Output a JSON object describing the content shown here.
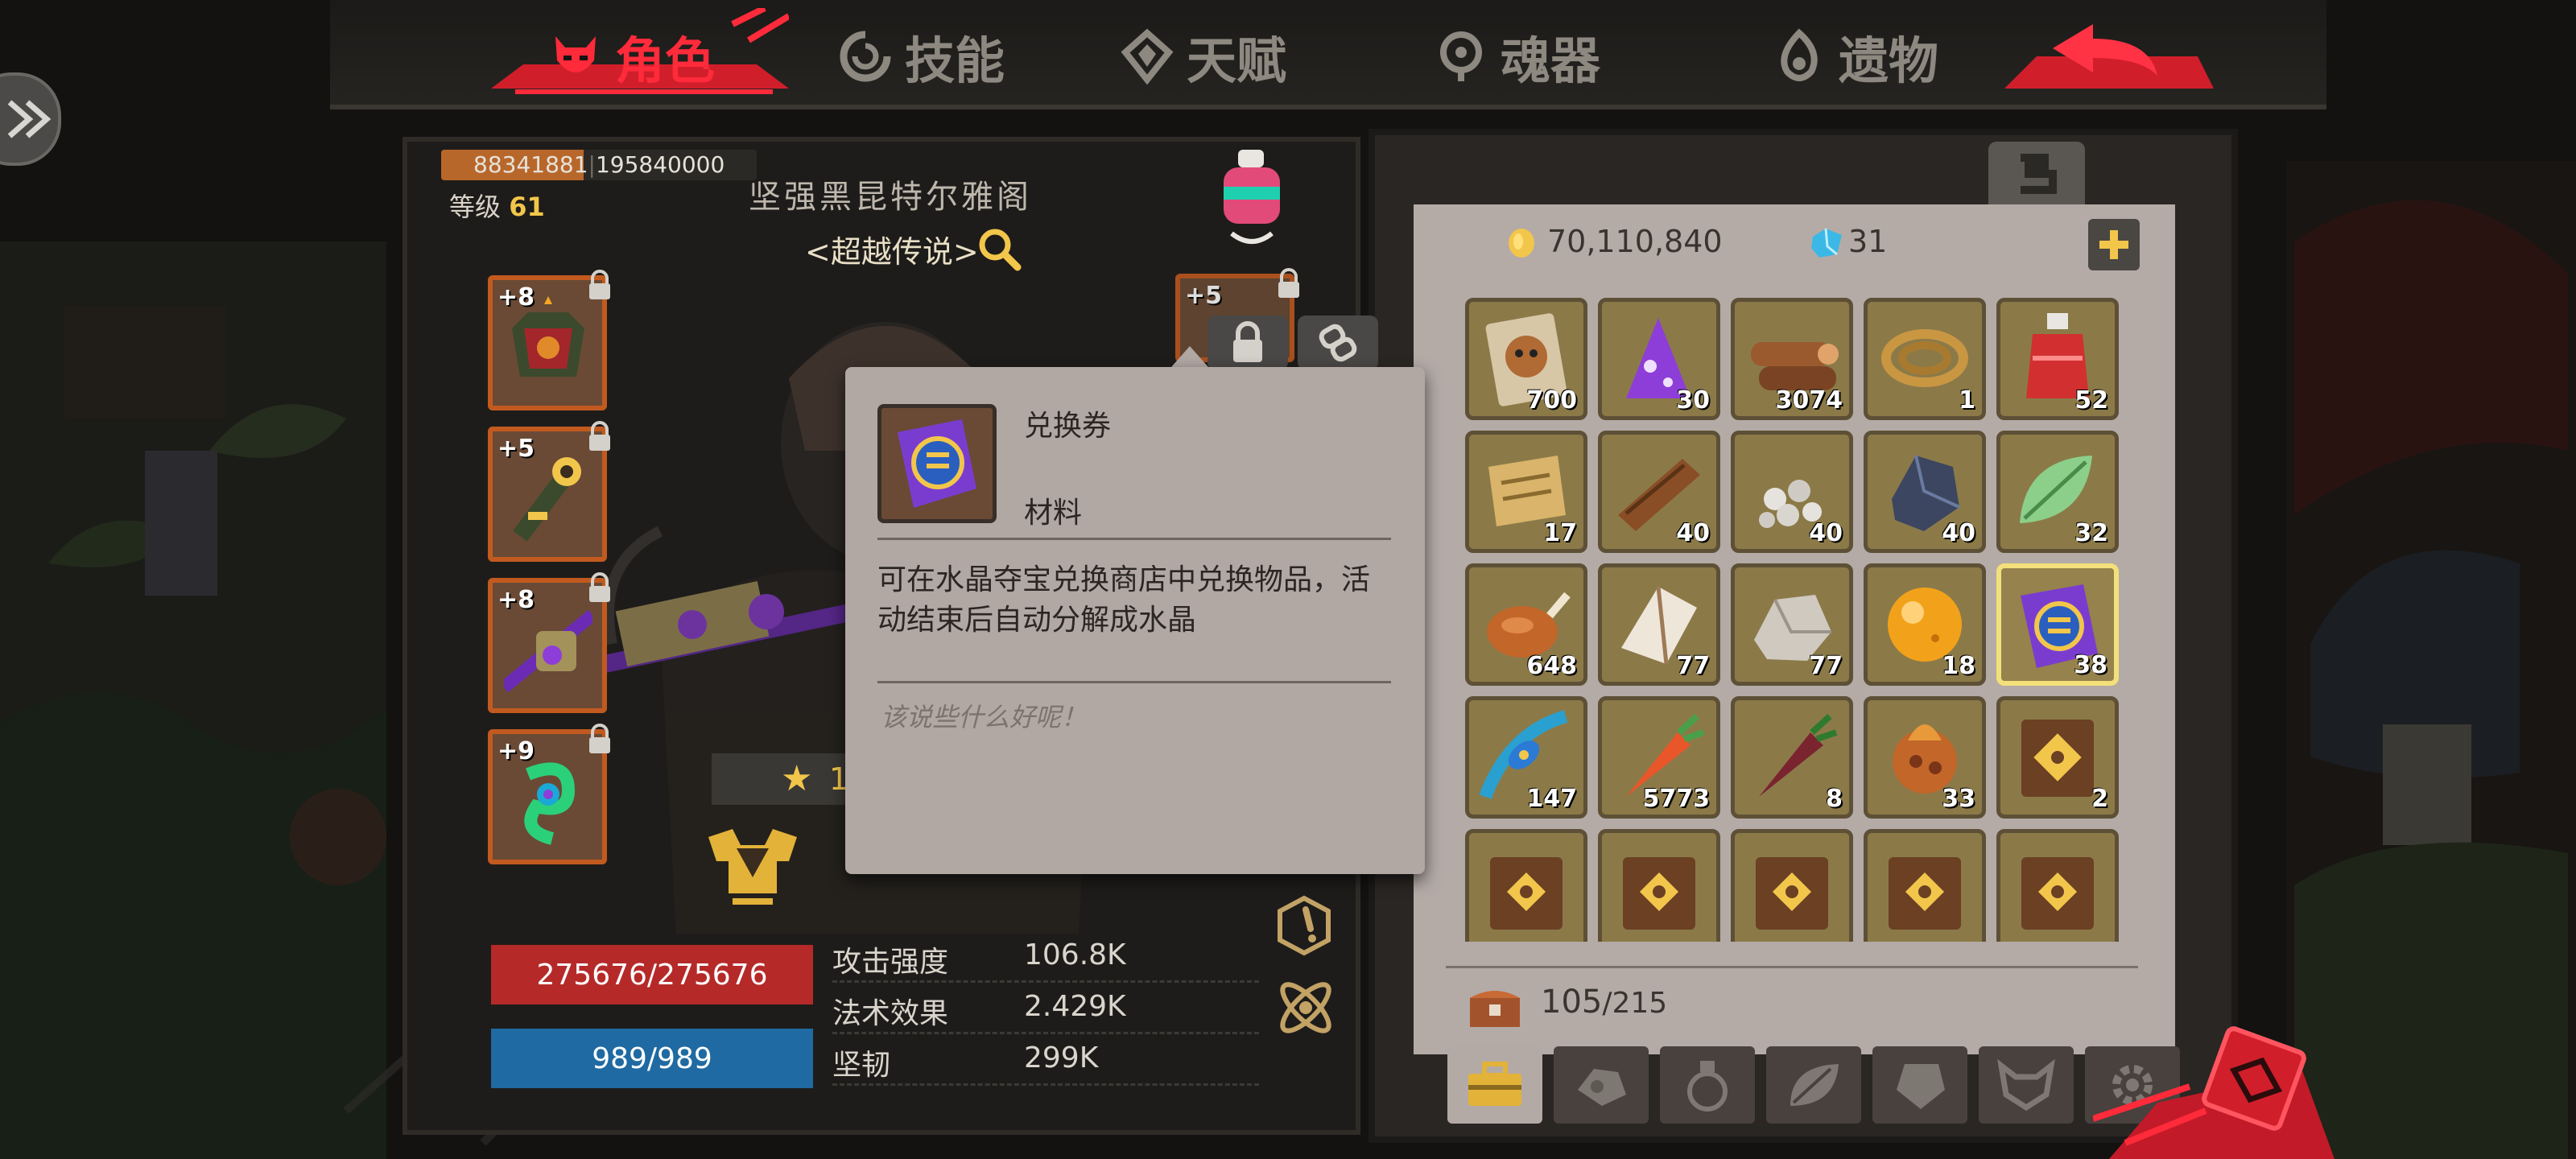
{
  "tabs": [
    {
      "label": "角色",
      "icon": "devil-face-icon",
      "active": true
    },
    {
      "label": "技能",
      "icon": "skill-swirl-icon",
      "active": false
    },
    {
      "label": "天赋",
      "icon": "talent-gem-icon",
      "active": false
    },
    {
      "label": "魂器",
      "icon": "soul-vessel-icon",
      "active": false
    },
    {
      "label": "遗物",
      "icon": "relic-flame-icon",
      "active": false
    }
  ],
  "character": {
    "exp_current": "88341881",
    "exp_max": "195840000",
    "exp_fraction": 0.451,
    "level_label": "等级",
    "level": "61",
    "name": "坚强黑昆特尔雅阁",
    "rank": "<超越传说>",
    "equipment": [
      {
        "level": "+8",
        "icon": "armor-icon",
        "locked": true
      },
      {
        "level": "+5",
        "icon": "key-weapon-icon",
        "locked": true
      },
      {
        "level": "+8",
        "icon": "crossbow-icon",
        "locked": true
      },
      {
        "level": "+9",
        "icon": "green-rune-icon",
        "locked": true
      },
      {
        "level": "+5",
        "icon": "claw-weapon-icon",
        "locked": true
      }
    ],
    "star_value": "1",
    "hp": "275676/275676",
    "mp": "989/989",
    "stats": [
      {
        "label": "攻击强度",
        "value": "106.8K"
      },
      {
        "label": "法术效果",
        "value": "2.429K"
      },
      {
        "label": "坚韧",
        "value": "299K"
      }
    ]
  },
  "tooltip": {
    "name": "兑换券",
    "type": "材料",
    "description": "可在水晶夺宝兑换商店中兑换物品，活动结束后自动分解成水晶",
    "flavor": "该说些什么好呢！"
  },
  "inventory": {
    "gold": "70,110,840",
    "gems": "31",
    "capacity_used": "105",
    "capacity_max": "/215",
    "items": [
      {
        "icon": "raccoon-card-icon",
        "qty": "700"
      },
      {
        "icon": "purple-crystal-icon",
        "qty": "30"
      },
      {
        "icon": "wood-logs-icon",
        "qty": "3074"
      },
      {
        "icon": "rope-coil-icon",
        "qty": "1"
      },
      {
        "icon": "red-potion-icon",
        "qty": "52"
      },
      {
        "icon": "scroll-map-icon",
        "qty": "17"
      },
      {
        "icon": "wood-plank-icon",
        "qty": "40"
      },
      {
        "icon": "gravel-icon",
        "qty": "40"
      },
      {
        "icon": "dark-ore-icon",
        "qty": "40"
      },
      {
        "icon": "green-leaf-icon",
        "qty": "32"
      },
      {
        "icon": "roast-chicken-icon",
        "qty": "648"
      },
      {
        "icon": "white-stone-icon",
        "qty": "77"
      },
      {
        "icon": "grey-rock-icon",
        "qty": "77"
      },
      {
        "icon": "orange-orb-icon",
        "qty": "18"
      },
      {
        "icon": "exchange-ticket-icon",
        "qty": "38",
        "selected": true
      },
      {
        "icon": "peacock-feather-icon",
        "qty": "147"
      },
      {
        "icon": "carrot-icon",
        "qty": "5773"
      },
      {
        "icon": "dark-carrot-icon",
        "qty": "8"
      },
      {
        "icon": "fire-fruit-icon",
        "qty": "33"
      },
      {
        "icon": "gold-book-icon",
        "qty": "2"
      },
      {
        "icon": "skill-book-icon",
        "qty": ""
      },
      {
        "icon": "skill-book-icon",
        "qty": ""
      },
      {
        "icon": "skill-book-icon",
        "qty": ""
      },
      {
        "icon": "skill-book-icon",
        "qty": ""
      },
      {
        "icon": "skill-book-icon",
        "qty": ""
      }
    ],
    "categories": [
      {
        "icon": "toolbox-icon",
        "active": true
      },
      {
        "icon": "ore-icon",
        "active": false
      },
      {
        "icon": "potion-icon",
        "active": false
      },
      {
        "icon": "leaf-icon",
        "active": false
      },
      {
        "icon": "gem-icon",
        "active": false
      },
      {
        "icon": "beast-icon",
        "active": false
      },
      {
        "icon": "gear-icon",
        "active": false
      }
    ]
  },
  "colors": {
    "accent_red": "#ff2a3a",
    "hp": "#b52a29",
    "mp": "#1f6aa2",
    "gold_text": "#f2c64b",
    "slot": "#8b7a48",
    "tooltip_bg": "#b1a7a3"
  }
}
